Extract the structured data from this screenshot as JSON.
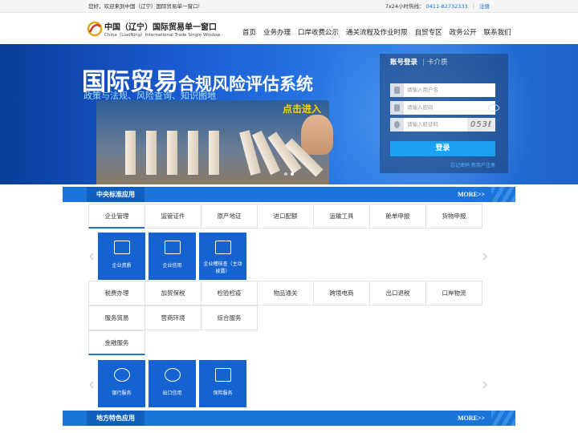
{
  "topbar": {
    "welcome": "您好，欢迎来到中国（辽宁）国际贸易单一窗口!",
    "hotline_label": "7x24小时热线：",
    "hotline": "0411-82732333",
    "separator": "|",
    "register": "注册"
  },
  "logo": {
    "title": "中国（辽宁）国际贸易单一窗口",
    "subtitle": "China（LiaoNing）International Trade Single Window"
  },
  "nav": [
    "首页",
    "业务办理",
    "口岸收费公示",
    "通关流程及作业时限",
    "自贸专区",
    "政务公开",
    "联系我们"
  ],
  "banner": {
    "title_big": "国际贸易",
    "title_small": "合规风险评估系统",
    "subtitle": "政策与法规、风险查询、知识图地",
    "cta": "点击进入"
  },
  "login": {
    "tab_account": "账号登录",
    "tab_sep": "|",
    "tab_card": "卡介质",
    "username_placeholder": "请输入用户名",
    "password_placeholder": "请输入密码",
    "captcha_placeholder": "请输入验证码",
    "captcha_text": "053ℓ",
    "login_button": "登录",
    "forgot": "忘记密码   新用户注册"
  },
  "section1": {
    "label": "中央标准应用",
    "more": "MORE>>",
    "tabs_row1": [
      "企业管理",
      "监管证件",
      "原产地证",
      "进口配额",
      "运输工具",
      "舱单申报",
      "货物申报"
    ],
    "tiles1": [
      "企业资质",
      "企业信用",
      "企业稽核查（主动披露）"
    ],
    "tabs_row2": [
      "税费办理",
      "加贸保税",
      "检验检疫",
      "物品通关",
      "跨境电商",
      "出口退税",
      "口岸物流"
    ],
    "tabs_row3": [
      "服务贸易",
      "营商环境",
      "综合服务"
    ],
    "tabs_row4": [
      "金融服务"
    ],
    "tiles2": [
      "银行服务",
      "出口信用",
      "保险服务"
    ]
  },
  "section2": {
    "label": "地方特色应用",
    "more": "MORE>>"
  }
}
